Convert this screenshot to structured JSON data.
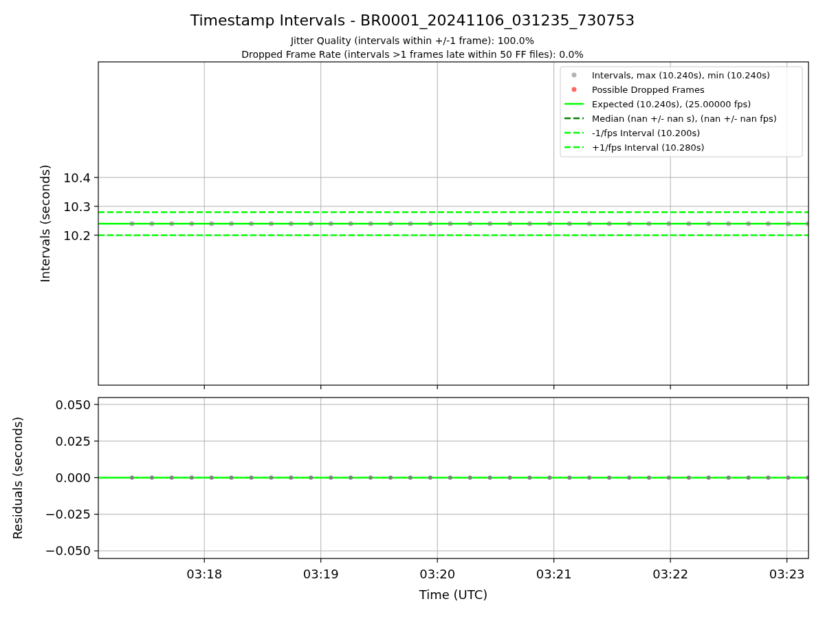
{
  "figure": {
    "title": "Timestamp Intervals - BR0001_20241106_031235_730753",
    "subtitles": [
      "Jitter Quality (intervals within +/-1 frame): 100.0%",
      "Dropped Frame Rate (intervals >1 frames late within 50 FF files): 0.0%"
    ]
  },
  "intervals_plot": {
    "chart_data": {
      "type": "scatter",
      "grid": true,
      "legend": "upper right",
      "ylabel": "Intervals (seconds)",
      "xlim": [
        197.09,
        203.185
      ],
      "ylim": [
        9.681,
        10.8
      ],
      "yticks": [
        10.2,
        10.3,
        10.4
      ],
      "x": [
        197.379,
        197.55,
        197.72,
        197.891,
        198.062,
        198.232,
        198.403,
        198.574,
        198.744,
        198.915,
        199.086,
        199.256,
        199.427,
        199.598,
        199.768,
        199.939,
        200.11,
        200.28,
        200.451,
        200.622,
        200.792,
        200.963,
        201.134,
        201.304,
        201.475,
        201.646,
        201.816,
        201.987,
        202.158,
        202.328,
        202.499,
        202.67,
        202.84,
        203.011,
        203.182
      ],
      "series": [
        {
          "name": "Intervals, max (10.240s), min (10.240s)",
          "color": "#808080",
          "values": [
            10.24,
            10.24,
            10.24,
            10.24,
            10.24,
            10.24,
            10.24,
            10.24,
            10.24,
            10.24,
            10.24,
            10.24,
            10.24,
            10.24,
            10.24,
            10.24,
            10.24,
            10.24,
            10.24,
            10.24,
            10.24,
            10.24,
            10.24,
            10.24,
            10.24,
            10.24,
            10.24,
            10.24,
            10.24,
            10.24,
            10.24,
            10.24,
            10.24,
            10.24,
            10.24
          ]
        },
        {
          "name": "Possible Dropped Frames",
          "color": "#ff0000",
          "values": [
            null,
            null,
            null,
            null,
            null,
            null,
            null,
            null,
            null,
            null,
            null,
            null,
            null,
            null,
            null,
            null,
            null,
            null,
            null,
            null,
            null,
            null,
            null,
            null,
            null,
            null,
            null,
            null,
            null,
            null,
            null,
            null,
            null,
            null,
            null
          ]
        }
      ],
      "ref_lines": [
        {
          "axis": "y",
          "label": "Expected (10.240s), (25.00000 fps)",
          "color": "#00ff00",
          "value": 10.24
        },
        {
          "axis": "y",
          "label": "Median (nan +/- nan s), (nan +/- nan fps)",
          "color": "#008000",
          "value": null
        },
        {
          "axis": "y",
          "label": "-1/fps Interval (10.200s)",
          "color": "#00ff00",
          "value": 10.2
        },
        {
          "axis": "y",
          "label": "+1/fps Interval (10.280s)",
          "color": "#00ff00",
          "value": 10.28
        }
      ]
    }
  },
  "residuals_plot": {
    "chart_data": {
      "type": "scatter",
      "grid": true,
      "xlabel": "Time (UTC)",
      "ylabel": "Residuals (seconds)",
      "xlim": [
        197.09,
        203.185
      ],
      "ylim": [
        -0.0552,
        0.0547
      ],
      "xticks": [
        {
          "value": 198,
          "label": "03:18"
        },
        {
          "value": 199,
          "label": "03:19"
        },
        {
          "value": 200,
          "label": "03:20"
        },
        {
          "value": 201,
          "label": "03:21"
        },
        {
          "value": 202,
          "label": "03:22"
        },
        {
          "value": 203,
          "label": "03:23"
        }
      ],
      "yticks": [
        {
          "value": 0.05,
          "label": "0.050"
        },
        {
          "value": 0.025,
          "label": "0.025"
        },
        {
          "value": 0,
          "label": "0.000"
        },
        {
          "value": -0.025,
          "label": "−0.025"
        },
        {
          "value": -0.05,
          "label": "−0.050"
        }
      ],
      "x": [
        197.379,
        197.55,
        197.72,
        197.891,
        198.062,
        198.232,
        198.403,
        198.574,
        198.744,
        198.915,
        199.086,
        199.256,
        199.427,
        199.598,
        199.768,
        199.939,
        200.11,
        200.28,
        200.451,
        200.622,
        200.792,
        200.963,
        201.134,
        201.304,
        201.475,
        201.646,
        201.816,
        201.987,
        202.158,
        202.328,
        202.499,
        202.67,
        202.84,
        203.011,
        203.182
      ],
      "series": [
        {
          "color": "#808080",
          "values": [
            0,
            0,
            0,
            0,
            0,
            0,
            0,
            0,
            0,
            0,
            0,
            0,
            0,
            0,
            0,
            0,
            0,
            0,
            0,
            0,
            0,
            0,
            0,
            0,
            0,
            0,
            0,
            0,
            0,
            0,
            0,
            0,
            0,
            0,
            0
          ]
        }
      ],
      "ref_lines": [
        {
          "axis": "y",
          "color": "#00ff00",
          "value": 0
        }
      ]
    }
  }
}
